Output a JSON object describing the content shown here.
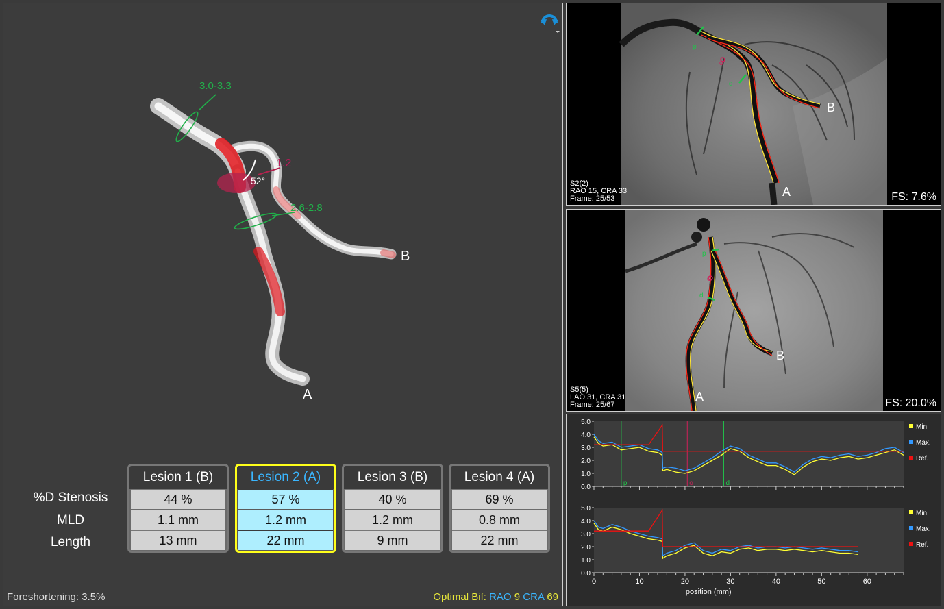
{
  "viewer3d": {
    "labels": {
      "proximal_diameter": "3.0-3.3",
      "distal_diameter": "2.6-2.8",
      "bifurcation_value": "1.2",
      "angle": "52°",
      "end_a": "A",
      "end_b": "B"
    },
    "rotate_icon": "rotate-arrows-icon",
    "dropdown_icon": "small-triangle-down-icon"
  },
  "lesion_table": {
    "row_labels": [
      "%D Stenosis",
      "MLD",
      "Length"
    ],
    "lesions": [
      {
        "title": "Lesion 1 (B)",
        "stenosis": "44 %",
        "mld": "1.1 mm",
        "length": "13 mm",
        "selected": false
      },
      {
        "title": "Lesion 2 (A)",
        "stenosis": "57 %",
        "mld": "1.2 mm",
        "length": "22 mm",
        "selected": true
      },
      {
        "title": "Lesion 3 (B)",
        "stenosis": "40 %",
        "mld": "1.2 mm",
        "length": "9 mm",
        "selected": false
      },
      {
        "title": "Lesion 4 (A)",
        "stenosis": "69 %",
        "mld": "0.8 mm",
        "length": "22 mm",
        "selected": false
      }
    ]
  },
  "status": {
    "foreshortening": "Foreshortening: 3.5%",
    "optimal_prefix": "Optimal Bif:",
    "rao_label": "RAO",
    "rao_value": "9",
    "cra_label": "CRA",
    "cra_value": "69"
  },
  "angio_views": [
    {
      "line1": "S2(2)",
      "line2": "RAO 15, CRA 33",
      "line3": "Frame: 25/53",
      "fs": "FS: 7.6%",
      "marker_a": "A",
      "marker_b": "B",
      "markers": [
        "p",
        "o",
        "d"
      ]
    },
    {
      "line1": "S5(5)",
      "line2": "LAO 31, CRA 31",
      "line3": "Frame: 25/67",
      "fs": "FS: 20.0%",
      "marker_a": "A",
      "marker_b": "B",
      "markers": [
        "p",
        "o",
        "d"
      ]
    }
  ],
  "colors": {
    "min": "#ffff33",
    "max": "#3399ff",
    "ref": "#ee1111",
    "accent": "#ffff1a",
    "vessel_green": "#21b04a"
  },
  "chart_data": [
    {
      "type": "line",
      "title": "",
      "xlim": [
        0,
        68
      ],
      "ylim": [
        0,
        5
      ],
      "yticks": [
        "5.0",
        "4.0",
        "3.0",
        "2.0",
        "1.0",
        "0.0"
      ],
      "legend": [
        "Min.",
        "Max.",
        "Ref."
      ],
      "markers": [
        {
          "name": "p",
          "x": 6
        },
        {
          "name": "o",
          "x": 20.5
        },
        {
          "name": "d",
          "x": 28.5
        }
      ],
      "series": [
        {
          "name": "Min.",
          "x": [
            0,
            1,
            2,
            4,
            6,
            8,
            10,
            12,
            14,
            15,
            15.1,
            16,
            18,
            20,
            22,
            24,
            26,
            28,
            30,
            32,
            34,
            36,
            38,
            40,
            42,
            44,
            46,
            48,
            50,
            52,
            54,
            56,
            58,
            60,
            62,
            64,
            66,
            68
          ],
          "y": [
            3.8,
            3.3,
            3.1,
            3.2,
            2.8,
            2.9,
            3.0,
            2.7,
            2.6,
            2.4,
            1.2,
            1.3,
            1.1,
            1.0,
            1.2,
            1.6,
            2.0,
            2.4,
            2.9,
            2.7,
            2.2,
            1.9,
            1.6,
            1.6,
            1.3,
            0.9,
            1.5,
            1.9,
            2.1,
            2.0,
            2.2,
            2.3,
            2.1,
            2.2,
            2.4,
            2.6,
            2.8,
            2.4
          ]
        },
        {
          "name": "Max.",
          "x": [
            0,
            1,
            2,
            4,
            6,
            8,
            10,
            12,
            14,
            15,
            15.1,
            16,
            18,
            20,
            22,
            24,
            26,
            28,
            30,
            32,
            34,
            36,
            38,
            40,
            42,
            44,
            46,
            48,
            50,
            52,
            54,
            56,
            58,
            60,
            62,
            64,
            66,
            68
          ],
          "y": [
            4.0,
            3.5,
            3.3,
            3.4,
            3.0,
            3.1,
            3.2,
            2.9,
            2.8,
            2.6,
            1.4,
            1.5,
            1.4,
            1.2,
            1.4,
            1.8,
            2.2,
            2.7,
            3.1,
            2.9,
            2.4,
            2.1,
            1.8,
            1.8,
            1.5,
            1.1,
            1.7,
            2.1,
            2.3,
            2.2,
            2.4,
            2.5,
            2.3,
            2.4,
            2.6,
            2.9,
            3.0,
            2.6
          ]
        },
        {
          "name": "Ref.",
          "x": [
            0,
            6,
            12,
            15,
            15.1,
            68
          ],
          "y": [
            3.2,
            3.2,
            3.2,
            4.7,
            2.7,
            2.7
          ]
        }
      ]
    },
    {
      "type": "line",
      "title": "",
      "xlabel": "position (mm)",
      "xlim": [
        0,
        68
      ],
      "ylim": [
        0,
        5
      ],
      "xticks": [
        "0",
        "10",
        "20",
        "30",
        "40",
        "50",
        "60"
      ],
      "yticks": [
        "5.0",
        "4.0",
        "3.0",
        "2.0",
        "1.0",
        "0.0"
      ],
      "legend": [
        "Min.",
        "Max.",
        "Ref."
      ],
      "series": [
        {
          "name": "Min.",
          "x": [
            0,
            1,
            2,
            4,
            6,
            8,
            10,
            12,
            14,
            15,
            15.1,
            16,
            18,
            20,
            22,
            24,
            26,
            28,
            30,
            32,
            34,
            36,
            38,
            40,
            42,
            44,
            46,
            48,
            50,
            52,
            54,
            56,
            58
          ],
          "y": [
            3.8,
            3.3,
            3.2,
            3.5,
            3.3,
            3.0,
            2.8,
            2.6,
            2.5,
            2.4,
            1.1,
            1.3,
            1.5,
            1.9,
            2.1,
            1.5,
            1.3,
            1.6,
            1.5,
            1.8,
            1.9,
            1.7,
            1.8,
            1.8,
            1.7,
            1.8,
            1.7,
            1.6,
            1.7,
            1.6,
            1.5,
            1.5,
            1.4
          ]
        },
        {
          "name": "Max.",
          "x": [
            0,
            1,
            2,
            4,
            6,
            8,
            10,
            12,
            14,
            15,
            15.1,
            16,
            18,
            20,
            22,
            24,
            26,
            28,
            30,
            32,
            34,
            36,
            38,
            40,
            42,
            44,
            46,
            48,
            50,
            52,
            54,
            56,
            58
          ],
          "y": [
            4.0,
            3.5,
            3.4,
            3.7,
            3.5,
            3.2,
            3.0,
            2.8,
            2.7,
            2.6,
            1.3,
            1.5,
            1.7,
            2.1,
            2.3,
            1.7,
            1.5,
            1.8,
            1.7,
            2.0,
            2.1,
            1.9,
            2.0,
            2.0,
            1.9,
            2.0,
            1.9,
            1.8,
            1.9,
            1.8,
            1.7,
            1.7,
            1.6
          ]
        },
        {
          "name": "Ref.",
          "x": [
            0,
            10,
            12,
            15,
            15.1,
            58
          ],
          "y": [
            3.2,
            3.2,
            3.2,
            4.8,
            2.0,
            2.0
          ]
        }
      ]
    }
  ]
}
